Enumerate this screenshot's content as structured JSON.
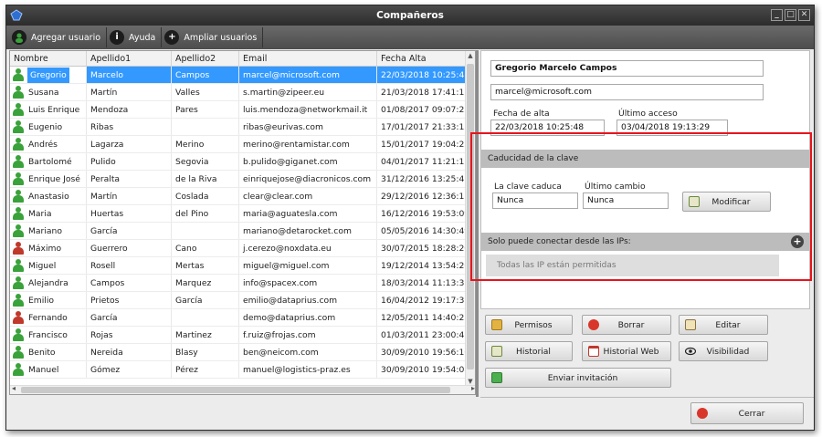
{
  "window": {
    "title": "Compañeros"
  },
  "toolbar": {
    "add_user": "Agregar usuario",
    "help": "Ayuda",
    "expand_users": "Ampliar usuarios"
  },
  "table": {
    "headers": [
      "Nombre",
      "Apellido1",
      "Apellido2",
      "Email",
      "Fecha Alta"
    ],
    "rows": [
      {
        "nombre": "Gregorio",
        "ap1": "Marcelo",
        "ap2": "Campos",
        "email": "marcel@microsoft.com",
        "fecha": "22/03/2018 10:25:48",
        "status": "active",
        "selected": true
      },
      {
        "nombre": "Susana",
        "ap1": "Martín",
        "ap2": "Valles",
        "email": "s.martin@zipeer.eu",
        "fecha": "21/03/2018 17:41:15",
        "status": "active"
      },
      {
        "nombre": "Luis Enrique",
        "ap1": "Mendoza",
        "ap2": "Pares",
        "email": "luis.mendoza@networkmail.it",
        "fecha": "01/08/2017 09:07:25",
        "status": "active"
      },
      {
        "nombre": "Eugenio",
        "ap1": "Ribas",
        "ap2": "",
        "email": "ribas@eurivas.com",
        "fecha": "17/01/2017 21:33:15",
        "status": "active"
      },
      {
        "nombre": "Andrés",
        "ap1": "Lagarza",
        "ap2": "Merino",
        "email": "merino@rentamistar.com",
        "fecha": "15/01/2017 19:04:22",
        "status": "active"
      },
      {
        "nombre": "Bartolomé",
        "ap1": "Pulido",
        "ap2": "Segovia",
        "email": "b.pulido@giganet.com",
        "fecha": "04/01/2017 11:21:13",
        "status": "active"
      },
      {
        "nombre": "Enrique José",
        "ap1": "Peralta",
        "ap2": "de la Riva",
        "email": "einriquejose@diacronicos.com",
        "fecha": "31/12/2016 13:25:41",
        "status": "active"
      },
      {
        "nombre": "Anastasio",
        "ap1": "Martín",
        "ap2": "Coslada",
        "email": "clear@clear.com",
        "fecha": "29/12/2016 12:36:11",
        "status": "active"
      },
      {
        "nombre": "Maria",
        "ap1": "Huertas",
        "ap2": "del Pino",
        "email": "maria@aguatesla.com",
        "fecha": "16/12/2016 19:53:09",
        "status": "active"
      },
      {
        "nombre": "Mariano",
        "ap1": "García",
        "ap2": "",
        "email": "mariano@detarocket.com",
        "fecha": "05/05/2016 14:30:49",
        "status": "active"
      },
      {
        "nombre": "Máximo",
        "ap1": "Guerrero",
        "ap2": "Cano",
        "email": "j.cerezo@noxdata.eu",
        "fecha": "30/07/2015 18:28:20",
        "status": "inactive"
      },
      {
        "nombre": "Miguel",
        "ap1": "Rosell",
        "ap2": "Mertas",
        "email": "miguel@miguel.com",
        "fecha": "19/12/2014 13:54:26",
        "status": "active"
      },
      {
        "nombre": "Alejandra",
        "ap1": "Campos",
        "ap2": "Marquez",
        "email": "info@spacex.com",
        "fecha": "18/03/2014 11:13:31",
        "status": "active"
      },
      {
        "nombre": "Emilio",
        "ap1": "Prietos",
        "ap2": "García",
        "email": "emilio@dataprius.com",
        "fecha": "16/04/2012 19:17:37",
        "status": "active"
      },
      {
        "nombre": "Fernando",
        "ap1": "García",
        "ap2": "",
        "email": "demo@dataprius.com",
        "fecha": "12/05/2011 14:40:25",
        "status": "inactive"
      },
      {
        "nombre": "Francisco",
        "ap1": "Rojas",
        "ap2": "Martinez",
        "email": "f.ruiz@frojas.com",
        "fecha": "01/03/2011 23:00:41",
        "status": "active"
      },
      {
        "nombre": "Benito",
        "ap1": "Nereida",
        "ap2": "Blasy",
        "email": "ben@neicom.com",
        "fecha": "30/09/2010 19:56:16",
        "status": "active"
      },
      {
        "nombre": "Manuel",
        "ap1": "Gómez",
        "ap2": "Pérez",
        "email": "manuel@logistics-praz.es",
        "fecha": "30/09/2010 19:54:08",
        "status": "active"
      }
    ]
  },
  "detail": {
    "full_name": "Gregorio Marcelo Campos",
    "email": "marcel@microsoft.com",
    "signup_label": "Fecha de alta",
    "signup_value": "22/03/2018 10:25:48",
    "last_access_label": "Último acceso",
    "last_access_value": "03/04/2018 19:13:29",
    "password_section": "Caducidad de la clave",
    "expires_label": "La clave caduca",
    "expires_value": "Nunca",
    "last_change_label": "Último cambio",
    "last_change_value": "Nunca",
    "modify_button": "Modificar",
    "ip_section": "Solo puede conectar desde las IPs:",
    "ip_placeholder": "Todas las IP están permitidas"
  },
  "actions": {
    "permisos": "Permisos",
    "borrar": "Borrar",
    "editar": "Editar",
    "historial": "Historial",
    "historial_web": "Historial Web",
    "visibilidad": "Visibilidad",
    "enviar_invitacion": "Enviar invitación",
    "cerrar": "Cerrar"
  },
  "colors": {
    "selection": "#3399ff",
    "user_active": "#3aa23a",
    "user_inactive": "#c0392b",
    "highlight": "#e8141c"
  }
}
